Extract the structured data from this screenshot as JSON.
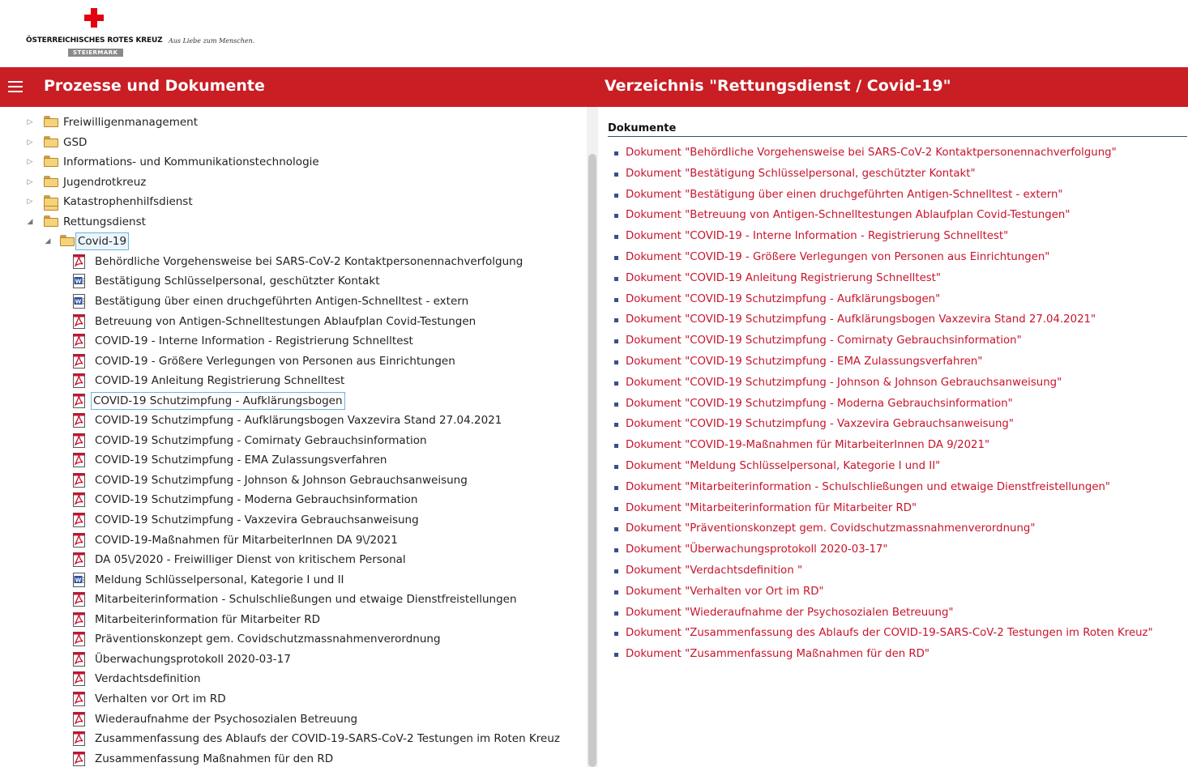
{
  "logo": {
    "org_name": "ÖSTERREICHISCHES ROTES KREUZ",
    "state": "STEIERMARK",
    "slogan": "Aus Liebe zum Menschen."
  },
  "header": {
    "left_title": "Prozesse und Dokumente",
    "right_title": "Verzeichnis \"Rettungsdienst / Covid-19\""
  },
  "tree": {
    "folders": [
      {
        "label": "Freiwilligenmanagement",
        "state": "collapsed"
      },
      {
        "label": "GSD",
        "state": "collapsed"
      },
      {
        "label": "Informations- und Kommunikationstechnologie",
        "state": "collapsed"
      },
      {
        "label": "Jugendrotkreuz",
        "state": "collapsed"
      },
      {
        "label": "Katastrophenhilfsdienst",
        "state": "collapsed"
      },
      {
        "label": "Rettungsdienst",
        "state": "expanded"
      }
    ],
    "subfolder": {
      "label": "Covid-19",
      "state": "expanded"
    },
    "files": [
      {
        "label": "Behördliche Vorgehensweise bei SARS-CoV-2 Kontaktpersonennachverfolgung",
        "type": "pdf"
      },
      {
        "label": "Bestätigung Schlüsselpersonal, geschützter Kontakt",
        "type": "word"
      },
      {
        "label": "Bestätigung über einen druchgeführten Antigen-Schnelltest - extern",
        "type": "word"
      },
      {
        "label": "Betreuung von Antigen-Schnelltestungen Ablaufplan Covid-Testungen",
        "type": "pdf"
      },
      {
        "label": "COVID-19 - Interne Information - Registrierung Schnelltest",
        "type": "pdf"
      },
      {
        "label": "COVID-19 - Größere Verlegungen von Personen aus Einrichtungen",
        "type": "pdf"
      },
      {
        "label": "COVID-19 Anleitung Registrierung Schnelltest",
        "type": "pdf"
      },
      {
        "label": "COVID-19 Schutzimpfung - Aufklärungsbogen",
        "type": "pdf"
      },
      {
        "label": "COVID-19 Schutzimpfung - Aufklärungsbogen Vaxzevira Stand 27.04.2021",
        "type": "pdf"
      },
      {
        "label": "COVID-19 Schutzimpfung - Comirnaty Gebrauchsinformation",
        "type": "pdf"
      },
      {
        "label": "COVID-19 Schutzimpfung - EMA Zulassungsverfahren",
        "type": "pdf"
      },
      {
        "label": "COVID-19 Schutzimpfung - Johnson & Johnson Gebrauchsanweisung",
        "type": "pdf"
      },
      {
        "label": "COVID-19 Schutzimpfung - Moderna Gebrauchsinformation",
        "type": "pdf"
      },
      {
        "label": "COVID-19 Schutzimpfung - Vaxzevira Gebrauchsanweisung",
        "type": "pdf"
      },
      {
        "label": "COVID-19-Maßnahmen für MitarbeiterInnen DA 9\\/2021",
        "type": "pdf"
      },
      {
        "label": "DA 05\\/2020 - Freiwilliger Dienst von kritischem Personal",
        "type": "pdf"
      },
      {
        "label": "Meldung Schlüsselpersonal, Kategorie I und II",
        "type": "word"
      },
      {
        "label": "Mitarbeiterinformation - Schulschließungen und etwaige Dienstfreistellungen",
        "type": "pdf"
      },
      {
        "label": "Mitarbeiterinformation für Mitarbeiter RD",
        "type": "pdf"
      },
      {
        "label": "Präventionskonzept gem. Covidschutzmassnahmenverordnung",
        "type": "pdf"
      },
      {
        "label": "Überwachungsprotokoll 2020-03-17",
        "type": "pdf"
      },
      {
        "label": "Verdachtsdefinition",
        "type": "pdf"
      },
      {
        "label": "Verhalten vor Ort im RD",
        "type": "pdf"
      },
      {
        "label": "Wiederaufnahme der Psychosozialen Betreuung",
        "type": "pdf"
      },
      {
        "label": "Zusammenfassung des Ablaufs der COVID-19-SARS-CoV-2 Testungen im Roten Kreuz",
        "type": "pdf"
      },
      {
        "label": "Zusammenfassung Maßnahmen für den RD",
        "type": "pdf"
      }
    ]
  },
  "documents": {
    "heading": "Dokumente",
    "items": [
      "Dokument \"Behördliche Vorgehensweise bei SARS-CoV-2 Kontaktpersonennachverfolgung\"",
      "Dokument \"Bestätigung Schlüsselpersonal, geschützter Kontakt\"",
      "Dokument \"Bestätigung über einen druchgeführten Antigen-Schnelltest - extern\"",
      "Dokument \"Betreuung von Antigen-Schnelltestungen Ablaufplan Covid-Testungen\"",
      "Dokument \"COVID-19 - Interne Information - Registrierung Schnelltest\"",
      "Dokument \"COVID-19 - Größere Verlegungen von Personen aus Einrichtungen\"",
      "Dokument \"COVID-19 Anleitung Registrierung Schnelltest\"",
      "Dokument \"COVID-19 Schutzimpfung - Aufklärungsbogen\"",
      "Dokument \"COVID-19 Schutzimpfung - Aufklärungsbogen Vaxzevira Stand 27.04.2021\"",
      "Dokument \"COVID-19 Schutzimpfung - Comirnaty Gebrauchsinformation\"",
      "Dokument \"COVID-19 Schutzimpfung - EMA Zulassungsverfahren\"",
      "Dokument \"COVID-19 Schutzimpfung - Johnson & Johnson Gebrauchsanweisung\"",
      "Dokument \"COVID-19 Schutzimpfung - Moderna Gebrauchsinformation\"",
      "Dokument \"COVID-19 Schutzimpfung - Vaxzevira Gebrauchsanweisung\"",
      "Dokument \"COVID-19-Maßnahmen für MitarbeiterInnen DA 9/2021\"",
      "Dokument \"Meldung Schlüsselpersonal, Kategorie I und II\"",
      "Dokument \"Mitarbeiterinformation - Schulschließungen und etwaige Dienstfreistellungen\"",
      "Dokument \"Mitarbeiterinformation für Mitarbeiter RD\"",
      "Dokument \"Präventionskonzept gem. Covidschutzmassnahmenverordnung\"",
      "Dokument \"Überwachungsprotokoll 2020-03-17\"",
      "Dokument \"Verdachtsdefinition \"",
      "Dokument \"Verhalten vor Ort im RD\"",
      "Dokument \"Wiederaufnahme der Psychosozialen Betreuung\"",
      "Dokument \"Zusammenfassung des Ablaufs der COVID-19-SARS-CoV-2 Testungen im Roten Kreuz\"",
      "Dokument \"Zusammenfassung Maßnahmen für den RD\""
    ]
  },
  "colors": {
    "brand_red": "#c81e24",
    "link_red": "#c8142c",
    "bullet": "#3c4f86",
    "selection_border": "#6cb4de"
  }
}
